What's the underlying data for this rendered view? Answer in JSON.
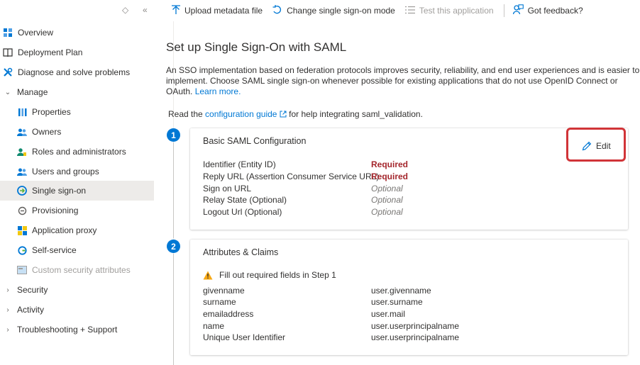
{
  "sidebar": {
    "items": [
      {
        "label": "Overview",
        "icon": "grid-icon",
        "kind": "top"
      },
      {
        "label": "Deployment Plan",
        "icon": "book-icon",
        "kind": "top"
      },
      {
        "label": "Diagnose and solve problems",
        "icon": "wrench-icon",
        "kind": "top"
      },
      {
        "label": "Manage",
        "icon": "chevron-down-icon",
        "kind": "group"
      },
      {
        "label": "Properties",
        "icon": "properties-icon",
        "kind": "sub"
      },
      {
        "label": "Owners",
        "icon": "owners-icon",
        "kind": "sub"
      },
      {
        "label": "Roles and administrators",
        "icon": "roles-icon",
        "kind": "sub"
      },
      {
        "label": "Users and groups",
        "icon": "users-icon",
        "kind": "sub"
      },
      {
        "label": "Single sign-on",
        "icon": "sso-icon",
        "kind": "sub",
        "selected": true
      },
      {
        "label": "Provisioning",
        "icon": "provisioning-icon",
        "kind": "sub"
      },
      {
        "label": "Application proxy",
        "icon": "app-proxy-icon",
        "kind": "sub"
      },
      {
        "label": "Self-service",
        "icon": "self-service-icon",
        "kind": "sub"
      },
      {
        "label": "Custom security attributes",
        "icon": "custom-attributes-icon",
        "kind": "sub",
        "disabled": true
      },
      {
        "label": "Security",
        "icon": "chevron-right-icon",
        "kind": "group"
      },
      {
        "label": "Activity",
        "icon": "chevron-right-icon",
        "kind": "group"
      },
      {
        "label": "Troubleshooting + Support",
        "icon": "chevron-right-icon",
        "kind": "group"
      }
    ]
  },
  "toolbar": {
    "upload_label": "Upload metadata file",
    "change_label": "Change single sign-on mode",
    "test_label": "Test this application",
    "feedback_label": "Got feedback?"
  },
  "main": {
    "title": "Set up Single Sign-On with SAML",
    "description": "An SSO implementation based on federation protocols improves security, reliability, and end user experiences and is easier to implement. Choose SAML single sign-on whenever possible for existing applications that do not use OpenID Connect or OAuth.",
    "learn_more": "Learn more.",
    "read_prefix": "Read the",
    "config_link": "configuration guide",
    "read_suffix": "for help integrating saml_validation."
  },
  "steps": [
    {
      "number": "1",
      "title": "Basic SAML Configuration",
      "edit_label": "Edit",
      "rows": [
        {
          "label": "Identifier (Entity ID)",
          "value": "Required",
          "status": "required"
        },
        {
          "label": "Reply URL (Assertion Consumer Service URL)",
          "value": "Required",
          "status": "required"
        },
        {
          "label": "Sign on URL",
          "value": "Optional",
          "status": "optional"
        },
        {
          "label": "Relay State (Optional)",
          "value": "Optional",
          "status": "optional"
        },
        {
          "label": "Logout Url (Optional)",
          "value": "Optional",
          "status": "optional"
        }
      ]
    },
    {
      "number": "2",
      "title": "Attributes & Claims",
      "warning": "Fill out required fields in Step 1",
      "rows": [
        {
          "label": "givenname",
          "value": "user.givenname"
        },
        {
          "label": "surname",
          "value": "user.surname"
        },
        {
          "label": "emailaddress",
          "value": "user.mail"
        },
        {
          "label": "name",
          "value": "user.userprincipalname"
        },
        {
          "label": "Unique User Identifier",
          "value": "user.userprincipalname"
        }
      ]
    }
  ],
  "colors": {
    "accent": "#0078d4",
    "required": "#a4262c",
    "highlight": "#d13438",
    "selected_bg": "#edebe9"
  }
}
